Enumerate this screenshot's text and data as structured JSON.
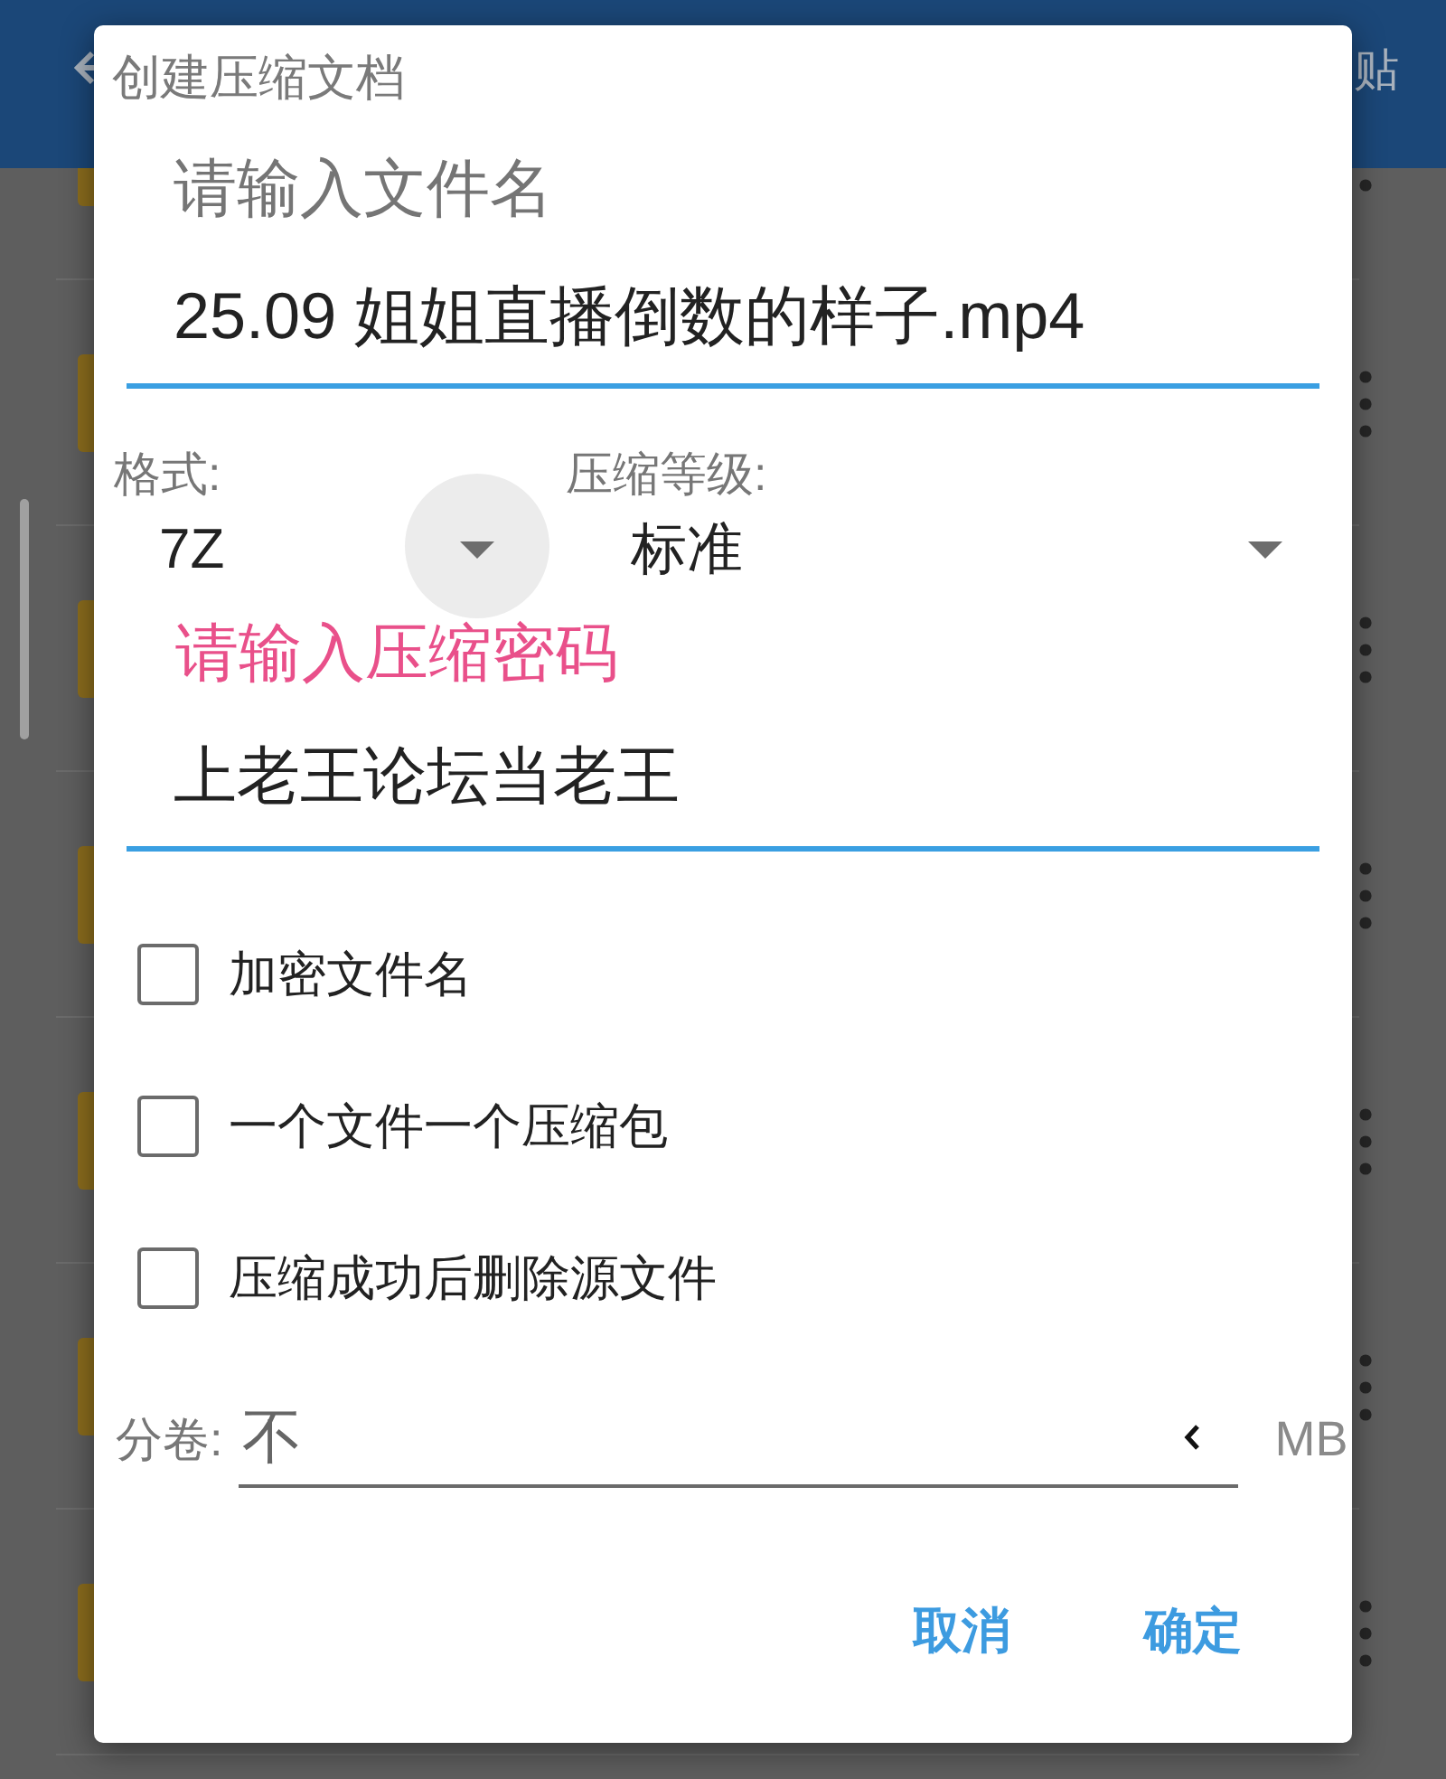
{
  "app_bar": {
    "action": "贴"
  },
  "file_list": {
    "rows": [
      {
        "kind": "folder"
      },
      {
        "kind": "folder"
      },
      {
        "kind": "folder"
      },
      {
        "kind": "folder"
      },
      {
        "kind": "folder"
      },
      {
        "kind": "folder"
      },
      {
        "kind": "folder"
      }
    ]
  },
  "dialog": {
    "title": "创建压缩文档",
    "filename": {
      "label": "请输入文件名",
      "value": "25.09 姐姐直播倒数的样子.mp4",
      "focused": false
    },
    "format": {
      "label": "格式:",
      "value": "7Z",
      "pressed": true
    },
    "level": {
      "label": "压缩等级:",
      "value": "标准",
      "pressed": false
    },
    "password": {
      "label": "请输入压缩密码",
      "value": "上老王论坛当老王",
      "focused": true
    },
    "options": [
      {
        "label": "加密文件名",
        "checked": false
      },
      {
        "label": "一个文件一个压缩包",
        "checked": false
      },
      {
        "label": "压缩成功后删除源文件",
        "checked": false
      }
    ],
    "split": {
      "label": "分卷:",
      "placeholder": "不",
      "unit": "MB"
    },
    "buttons": [
      "取消",
      "确定"
    ]
  }
}
